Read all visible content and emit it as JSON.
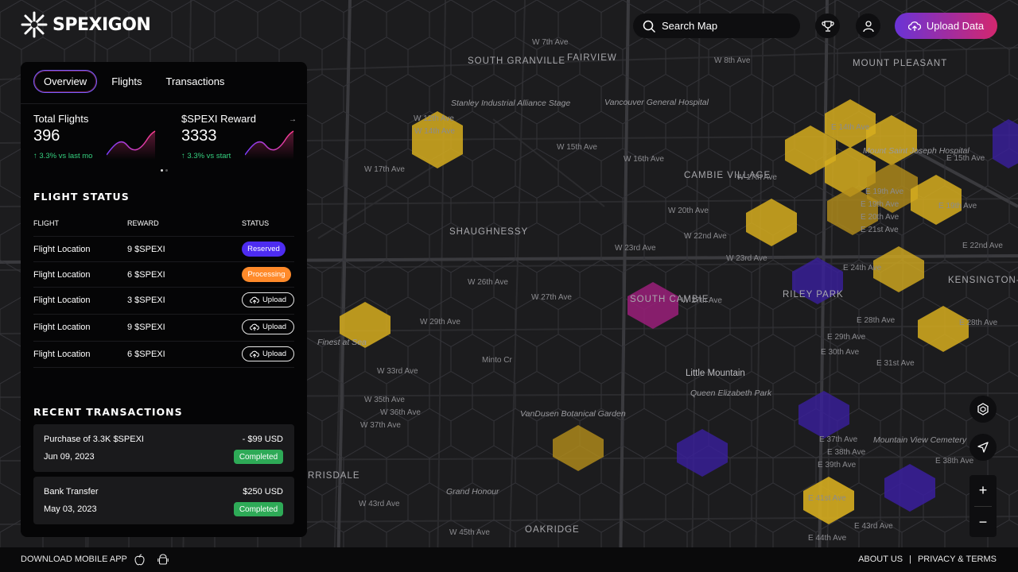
{
  "brand": {
    "name": "SPEXIGON"
  },
  "header": {
    "search_label": "Search Map",
    "upload_label": "Upload Data"
  },
  "panel": {
    "tabs": [
      {
        "label": "Overview"
      },
      {
        "label": "Flights"
      },
      {
        "label": "Transactions"
      }
    ],
    "stats": [
      {
        "label": "Total Flights",
        "value": "396",
        "change": "3.3% vs last mo"
      },
      {
        "label": "$SPEXI Reward",
        "value": "3333",
        "change": "3.3% vs start"
      }
    ],
    "flight_status": {
      "title": "FLIGHT STATUS",
      "columns": [
        "FLIGHT",
        "REWARD",
        "STATUS"
      ],
      "rows": [
        {
          "flight": "Flight Location",
          "reward": "9 $SPEXI",
          "status": "Reserved"
        },
        {
          "flight": "Flight Location",
          "reward": "6 $SPEXI",
          "status": "Processing"
        },
        {
          "flight": "Flight Location",
          "reward": "3 $SPEXI",
          "status": "Upload"
        },
        {
          "flight": "Flight Location",
          "reward": "9 $SPEXI",
          "status": "Upload"
        },
        {
          "flight": "Flight Location",
          "reward": "6 $SPEXI",
          "status": "Upload"
        }
      ]
    },
    "recent_transactions": {
      "title": "RECENT TRANSACTIONS",
      "items": [
        {
          "desc": "Purchase of 3.3K $SPEXI",
          "amount": "- $99 USD",
          "date": "Jun 09, 2023",
          "status": "Completed"
        },
        {
          "desc": "Bank Transfer",
          "amount": "$250 USD",
          "date": "May 03, 2023",
          "status": "Completed"
        }
      ]
    }
  },
  "map": {
    "labels": {
      "fairview": "FAIRVIEW",
      "south_granville": "SOUTH GRANVILLE",
      "mount_pleasant": "MOUNT PLEASANT",
      "cambie_village": "CAMBIE VILLAGE",
      "shaughnessy": "SHAUGHNESSY",
      "south_cambie": "SOUTH CAMBIE",
      "riley_park": "RILEY PARK",
      "kensington": "KENSINGTON-CEDAR COTTAGE",
      "little_mountain": "Little Mountain",
      "queen_elizabeth": "Queen Elizabeth Park",
      "vgh": "Vancouver General Hospital",
      "msj": "Mount Saint Joseph Hospital",
      "vandusen": "VanDusen Botanical Garden",
      "mountain_view": "Mountain View Cemetery",
      "oakridge": "OAKRIDGE",
      "stanley": "Stanley Industrial Alliance Stage",
      "finest": "Finest at Sea",
      "grand_honour": "Grand Honour",
      "minto": "Minto Cr",
      "w12": "W 12th Ave",
      "w14": "W 14th Ave",
      "w15": "W 15th Ave",
      "w16": "W 16th Ave",
      "w17": "W 17th Ave",
      "w20": "W 20th Ave",
      "w22": "W 22nd Ave",
      "w23": "W 23rd Ave",
      "w26": "W 26th Ave",
      "w27": "W 27th Ave",
      "w29": "W 29th Ave",
      "w33": "W 33rd Ave",
      "w35": "W 35th Ave",
      "w36": "W 36th Ave",
      "w37": "W 37th Ave",
      "w43": "W 43rd Ave",
      "w45": "W 45th Ave",
      "w7": "W 7th Ave",
      "w8": "W 8th Ave",
      "e14": "E 14th Ave",
      "e15": "E 15th Ave",
      "e17": "E 17th Ave",
      "e19": "E 19th Ave",
      "e20": "E 20th Ave",
      "e21": "E 21st Ave",
      "e22": "E 22nd Ave",
      "e24": "E 24th Ave",
      "e28": "E 28th Ave",
      "e29": "E 29th Ave",
      "e30": "E 30th Ave",
      "e31": "E 31st Ave",
      "e37": "E 37th Ave",
      "e38": "E 38th Ave",
      "e39": "E 39th Ave",
      "e41": "E 41st Ave",
      "e43": "E 43rd Ave",
      "e44": "E 44th Ave",
      "kerrisdale": "RRISDALE"
    }
  },
  "footer": {
    "download": "DOWNLOAD MOBILE APP",
    "about": "ABOUT US",
    "sep": "|",
    "privacy": "PRIVACY & TERMS"
  },
  "colors": {
    "accent_gradient_start": "#6a33d6",
    "accent_gradient_end": "#d3276e",
    "hex_yellow": "#d6ad1f",
    "hex_purple": "#3a1f9e",
    "hex_magenta": "#9a1f7a"
  }
}
